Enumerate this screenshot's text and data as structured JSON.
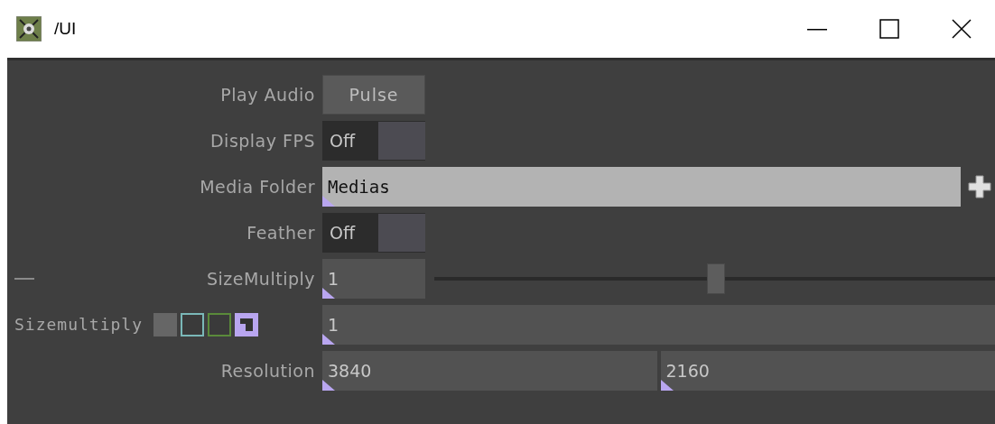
{
  "window": {
    "title": "/UI"
  },
  "parameters": [
    {
      "kind": "pulse",
      "label": "Play Audio",
      "button": "Pulse"
    },
    {
      "kind": "toggle",
      "label": "Display FPS",
      "value": "Off",
      "on": false
    },
    {
      "kind": "folder",
      "label": "Media Folder",
      "value": "Medias"
    },
    {
      "kind": "toggle",
      "label": "Feather",
      "value": "Off",
      "on": false
    },
    {
      "kind": "slider",
      "label": "SizeMultiply",
      "value": "1",
      "level": 0.5
    },
    {
      "kind": "expression",
      "label": "Sizemultiply",
      "value": "1"
    },
    {
      "kind": "pair",
      "label": "Resolution",
      "values": [
        "3840",
        "2160"
      ]
    }
  ]
}
